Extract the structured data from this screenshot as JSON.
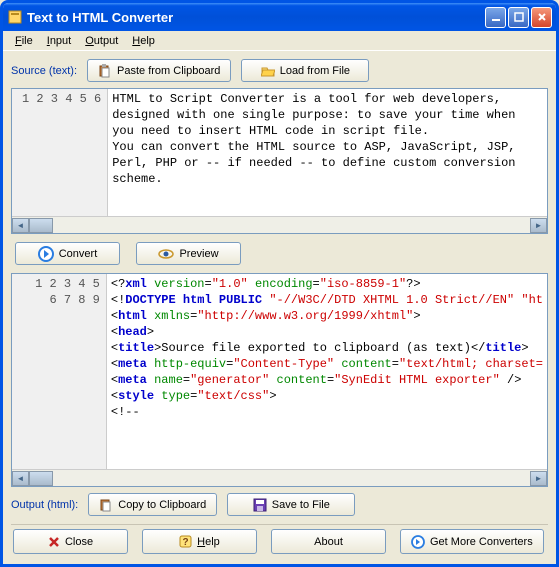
{
  "window": {
    "title": "Text to HTML Converter"
  },
  "menu": {
    "file": "File",
    "input": "Input",
    "output": "Output",
    "help": "Help"
  },
  "source": {
    "label": "Source (text):",
    "paste_btn": "Paste from Clipboard",
    "load_btn": "Load from File",
    "lines": [
      "1",
      "2",
      "3",
      "4",
      "5",
      "6"
    ],
    "text": "HTML to Script Converter is a tool for web developers,\ndesigned with one single purpose: to save your time when\nyou need to insert HTML code in script file.\nYou can convert the HTML source to ASP, JavaScript, JSP,\nPerl, PHP or -- if needed -- to define custom conversion\nscheme."
  },
  "actions": {
    "convert": "Convert",
    "preview": "Preview"
  },
  "output": {
    "label": "Output (html):",
    "copy_btn": "Copy to Clipboard",
    "save_btn": "Save to File",
    "lines": [
      "1",
      "2",
      "3",
      "4",
      "5",
      "6",
      "7",
      "8",
      "9"
    ],
    "code": [
      {
        "pre": "<?",
        "tag": "xml",
        "attrs": [
          [
            "version",
            "\"1.0\""
          ],
          [
            "encoding",
            "\"iso-8859-1\""
          ]
        ],
        "post": "?>"
      },
      {
        "pre": "<!",
        "tag": "DOCTYPE",
        "plain": " html PUBLIC ",
        "str": "\"-//W3C//DTD XHTML 1.0 Strict//EN\" \"ht"
      },
      {
        "pre": "<",
        "tag": "html",
        "attrs": [
          [
            "xmlns",
            "\"http://www.w3.org/1999/xhtml\""
          ]
        ],
        "post": ">"
      },
      {
        "pre": "<",
        "tag": "head",
        "post": ">"
      },
      {
        "title_line": true,
        "open": "<",
        "tag": "title",
        "txt": "Source file exported to clipboard (as text)",
        "close": "</",
        "tag2": "title",
        "end": ">"
      },
      {
        "pre": "<",
        "tag": "meta",
        "attrs": [
          [
            "http-equiv",
            "\"Content-Type\""
          ],
          [
            "content",
            "\"text/html; charset="
          ]
        ]
      },
      {
        "pre": "<",
        "tag": "meta",
        "attrs": [
          [
            "name",
            "\"generator\""
          ],
          [
            "content",
            "\"SynEdit HTML exporter\""
          ]
        ],
        "post": " />"
      },
      {
        "pre": "<",
        "tag": "style",
        "attrs": [
          [
            "type",
            "\"text/css\""
          ]
        ],
        "post": ">"
      },
      {
        "comment": "<!--"
      }
    ]
  },
  "bottom": {
    "close": "Close",
    "help": "Help",
    "about": "About",
    "more": "Get More Converters"
  }
}
